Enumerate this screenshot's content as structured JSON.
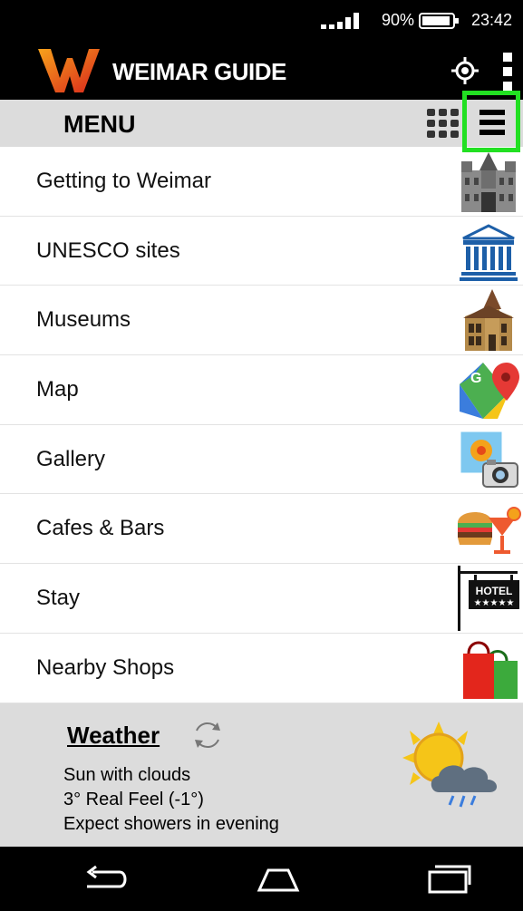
{
  "status": {
    "battery": "90%",
    "time": "23:42"
  },
  "header": {
    "title": "WEIMAR GUIDE"
  },
  "menu": {
    "title": "MENU"
  },
  "items": [
    {
      "label": "Getting to Weimar",
      "icon": "castle-icon"
    },
    {
      "label": "UNESCO sites",
      "icon": "unesco-icon"
    },
    {
      "label": "Museums",
      "icon": "museum-building-icon"
    },
    {
      "label": "Map",
      "icon": "google-maps-icon"
    },
    {
      "label": "Gallery",
      "icon": "photo-gallery-icon"
    },
    {
      "label": "Cafes & Bars",
      "icon": "burger-cocktail-icon"
    },
    {
      "label": "Stay",
      "icon": "hotel-sign-icon"
    },
    {
      "label": "Nearby Shops",
      "icon": "shopping-bags-icon"
    }
  ],
  "weather": {
    "title": "Weather",
    "condition": "Sun with clouds",
    "temp": "3° Real Feel (-1°)",
    "forecast": "Expect showers in evening"
  },
  "colors": {
    "highlight": "#22e022",
    "accent": "#e8601c"
  }
}
